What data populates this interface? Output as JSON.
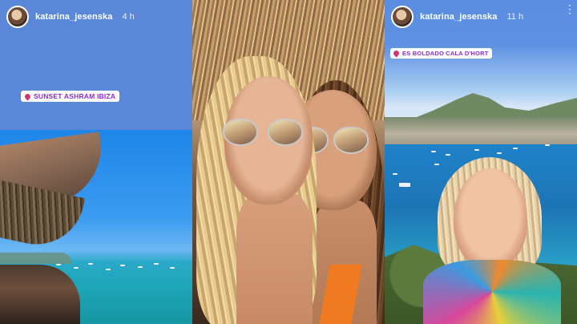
{
  "stories": [
    {
      "username": "katarina_jesenska",
      "time": "4 h",
      "location": "SUNSET ASHRAM IBIZA"
    },
    {
      "username": "katarina_jesenska",
      "time": "11 h",
      "location": "ES BOLDADO CALA D'HORT"
    }
  ],
  "icons": {
    "menu": "more-vertical-icon",
    "location": "location-pin-icon",
    "avatar": "profile-avatar"
  },
  "colors": {
    "left_top_bg": "#5b87d8",
    "location_text": "#8e2bd0",
    "location_pin": "#d2357a"
  }
}
